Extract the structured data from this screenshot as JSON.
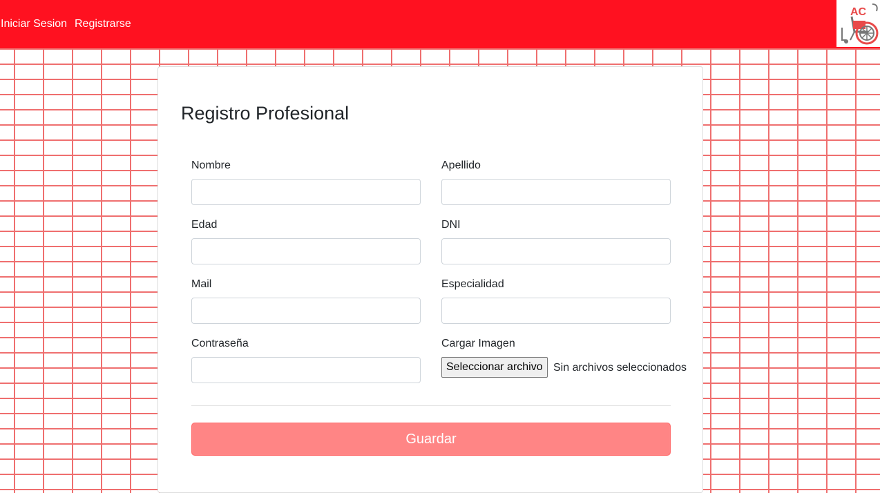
{
  "nav": {
    "login_label": "Iniciar Sesion",
    "register_label": "Registrarse",
    "logo_text": "AC"
  },
  "form": {
    "title": "Registro Profesional",
    "fields": {
      "nombre": {
        "label": "Nombre",
        "value": ""
      },
      "apellido": {
        "label": "Apellido",
        "value": ""
      },
      "edad": {
        "label": "Edad",
        "value": ""
      },
      "dni": {
        "label": "DNI",
        "value": ""
      },
      "mail": {
        "label": "Mail",
        "value": ""
      },
      "especialidad": {
        "label": "Especialidad",
        "value": ""
      },
      "contrasena": {
        "label": "Contraseña",
        "value": ""
      },
      "imagen": {
        "label": "Cargar Imagen",
        "button_label": "Seleccionar archivo",
        "status": "Sin archivos seleccionados"
      }
    },
    "submit_label": "Guardar"
  },
  "colors": {
    "navbar": "#ff1120",
    "brick_lines": "#ef6f6f",
    "submit_button": "#ff8585"
  }
}
